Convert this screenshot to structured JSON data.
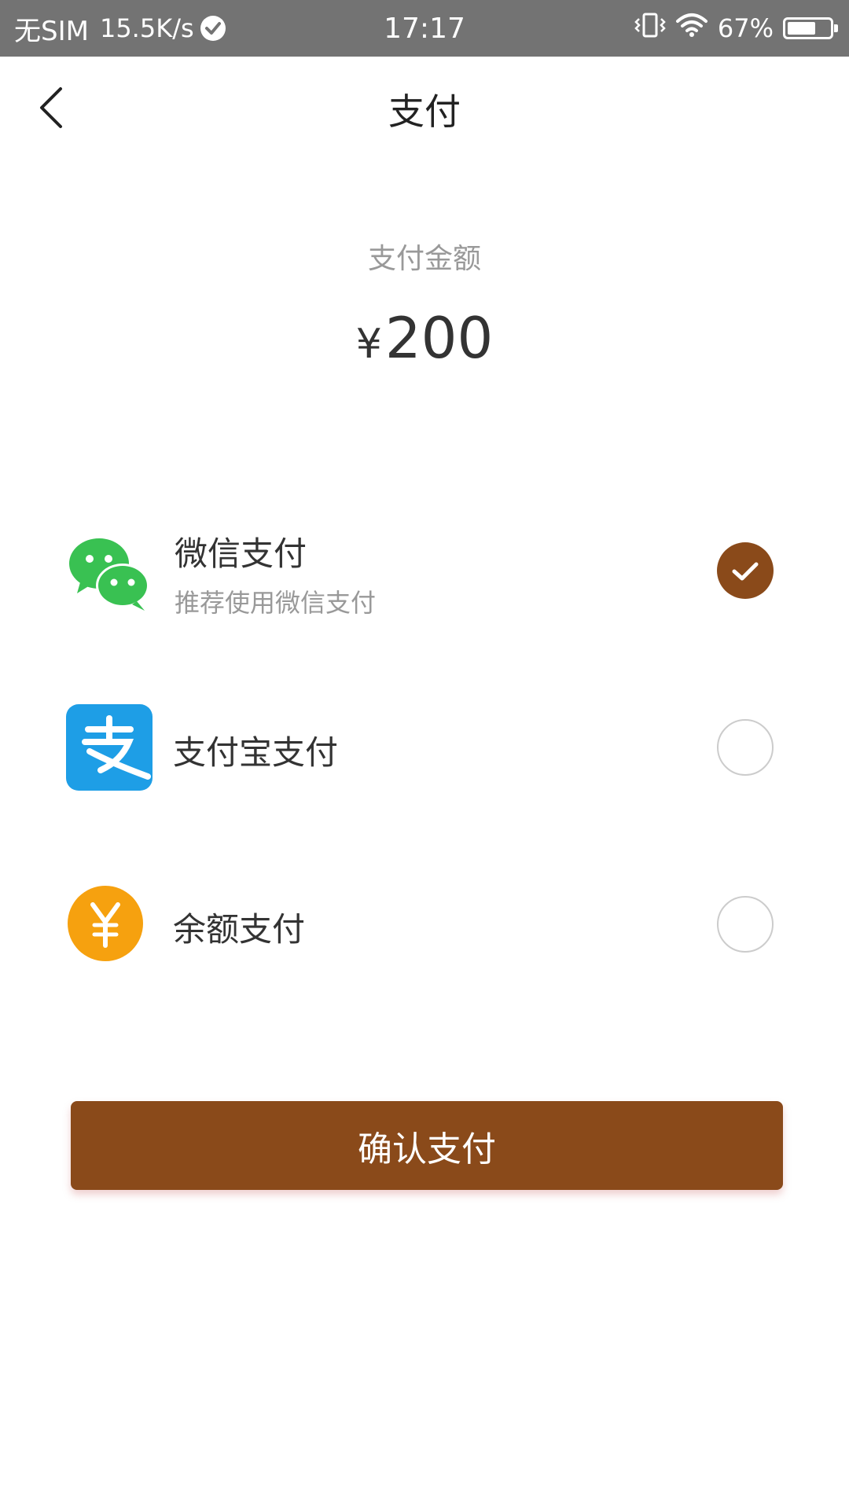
{
  "status_bar": {
    "carrier": "无SIM",
    "speed": "15.5K/s",
    "time": "17:17",
    "battery": "67%",
    "battery_level": 0.67
  },
  "nav": {
    "back_icon": "chevron-left-icon",
    "title": "支付"
  },
  "amount": {
    "label": "支付金额",
    "currency": "¥",
    "value": "200"
  },
  "payment_options": [
    {
      "name": "微信支付",
      "subtitle": "推荐使用微信支付",
      "icon": "wechat-icon",
      "selected": true
    },
    {
      "name": "支付宝支付",
      "icon": "alipay-icon",
      "selected": false
    },
    {
      "name": "余额支付",
      "icon": "balance-yen-icon",
      "selected": false
    }
  ],
  "confirm_button": {
    "label": "确认支付"
  },
  "colors": {
    "accent": "#8a4a1a",
    "status_bar": "#737373",
    "wechat": "#39c152",
    "alipay": "#1e9ee6",
    "balance": "#f6a10f"
  }
}
